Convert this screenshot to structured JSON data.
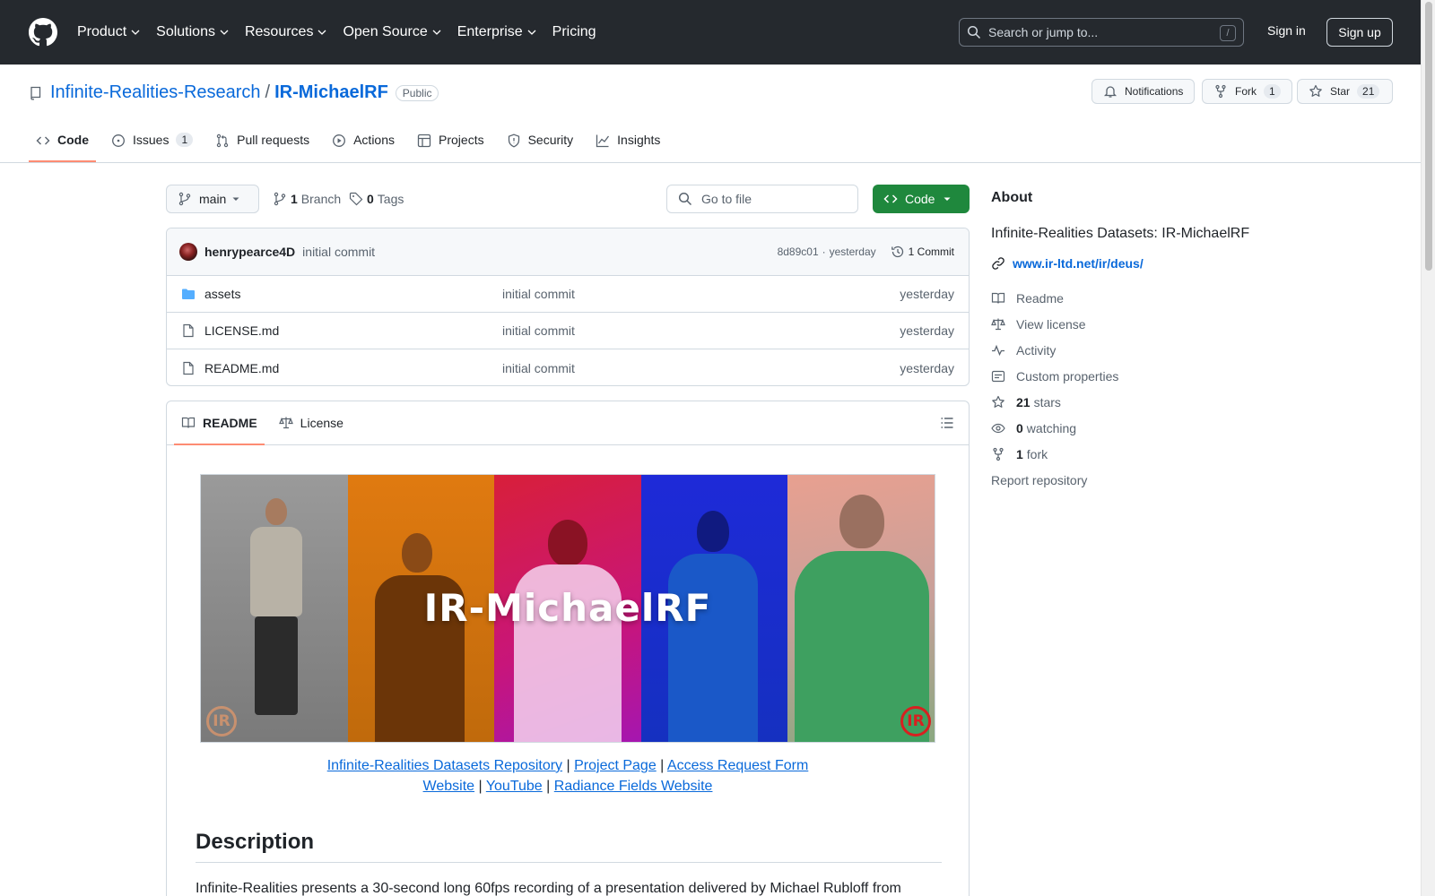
{
  "header": {
    "nav": [
      "Product",
      "Solutions",
      "Resources",
      "Open Source",
      "Enterprise",
      "Pricing"
    ],
    "search_placeholder": "Search or jump to...",
    "search_shortcut": "/",
    "sign_in": "Sign in",
    "sign_up": "Sign up"
  },
  "repo": {
    "owner": "Infinite-Realities-Research",
    "separator": "/",
    "name": "IR-MichaelRF",
    "visibility": "Public",
    "notifications_label": "Notifications",
    "fork_label": "Fork",
    "fork_count": "1",
    "star_label": "Star",
    "star_count": "21"
  },
  "tabs": {
    "code": "Code",
    "issues": "Issues",
    "issues_count": "1",
    "pulls": "Pull requests",
    "actions": "Actions",
    "projects": "Projects",
    "security": "Security",
    "insights": "Insights"
  },
  "filenav": {
    "branch": "main",
    "branch_count": "1",
    "branch_label": "Branch",
    "tag_count": "0",
    "tag_label": "Tags",
    "goto_placeholder": "Go to file",
    "code_button": "Code"
  },
  "commit": {
    "author": "henrypearce4D",
    "message": "initial commit",
    "hash": "8d89c01",
    "dot": "·",
    "time": "yesterday",
    "count_label": "1 Commit"
  },
  "files": [
    {
      "name": "assets",
      "message": "initial commit",
      "date": "yesterday"
    },
    {
      "name": "LICENSE.md",
      "message": "initial commit",
      "date": "yesterday"
    },
    {
      "name": "README.md",
      "message": "initial commit",
      "date": "yesterday"
    }
  ],
  "readme": {
    "tab_readme": "README",
    "tab_license": "License",
    "banner_title": "IR-MichaelRF",
    "logo_text": "IR",
    "links_line1": [
      {
        "text": "Infinite-Realities Datasets Repository"
      },
      {
        "text": "Project Page"
      },
      {
        "text": "Access Request Form"
      }
    ],
    "links_line2": [
      {
        "text": "Website"
      },
      {
        "text": "YouTube"
      },
      {
        "text": "Radiance Fields Website"
      }
    ],
    "pipe": "|",
    "description_heading": "Description",
    "description_text": "Infinite-Realities presents a 30-second long 60fps recording of a presentation delivered by Michael Rubloff from"
  },
  "about": {
    "heading": "About",
    "description": "Infinite-Realities Datasets: IR-MichaelRF",
    "website": "www.ir-ltd.net/ir/deus/",
    "readme": "Readme",
    "license": "View license",
    "activity": "Activity",
    "custom_properties": "Custom properties",
    "stars_count": "21",
    "stars_label": "stars",
    "watching_count": "0",
    "watching_label": "watching",
    "forks_count": "1",
    "forks_label": "fork",
    "report": "Report repository"
  },
  "colors": {
    "header_bg": "#25292e",
    "link": "#0969da",
    "code_button": "#1f883d",
    "tab_underline": "#fd8c73"
  }
}
